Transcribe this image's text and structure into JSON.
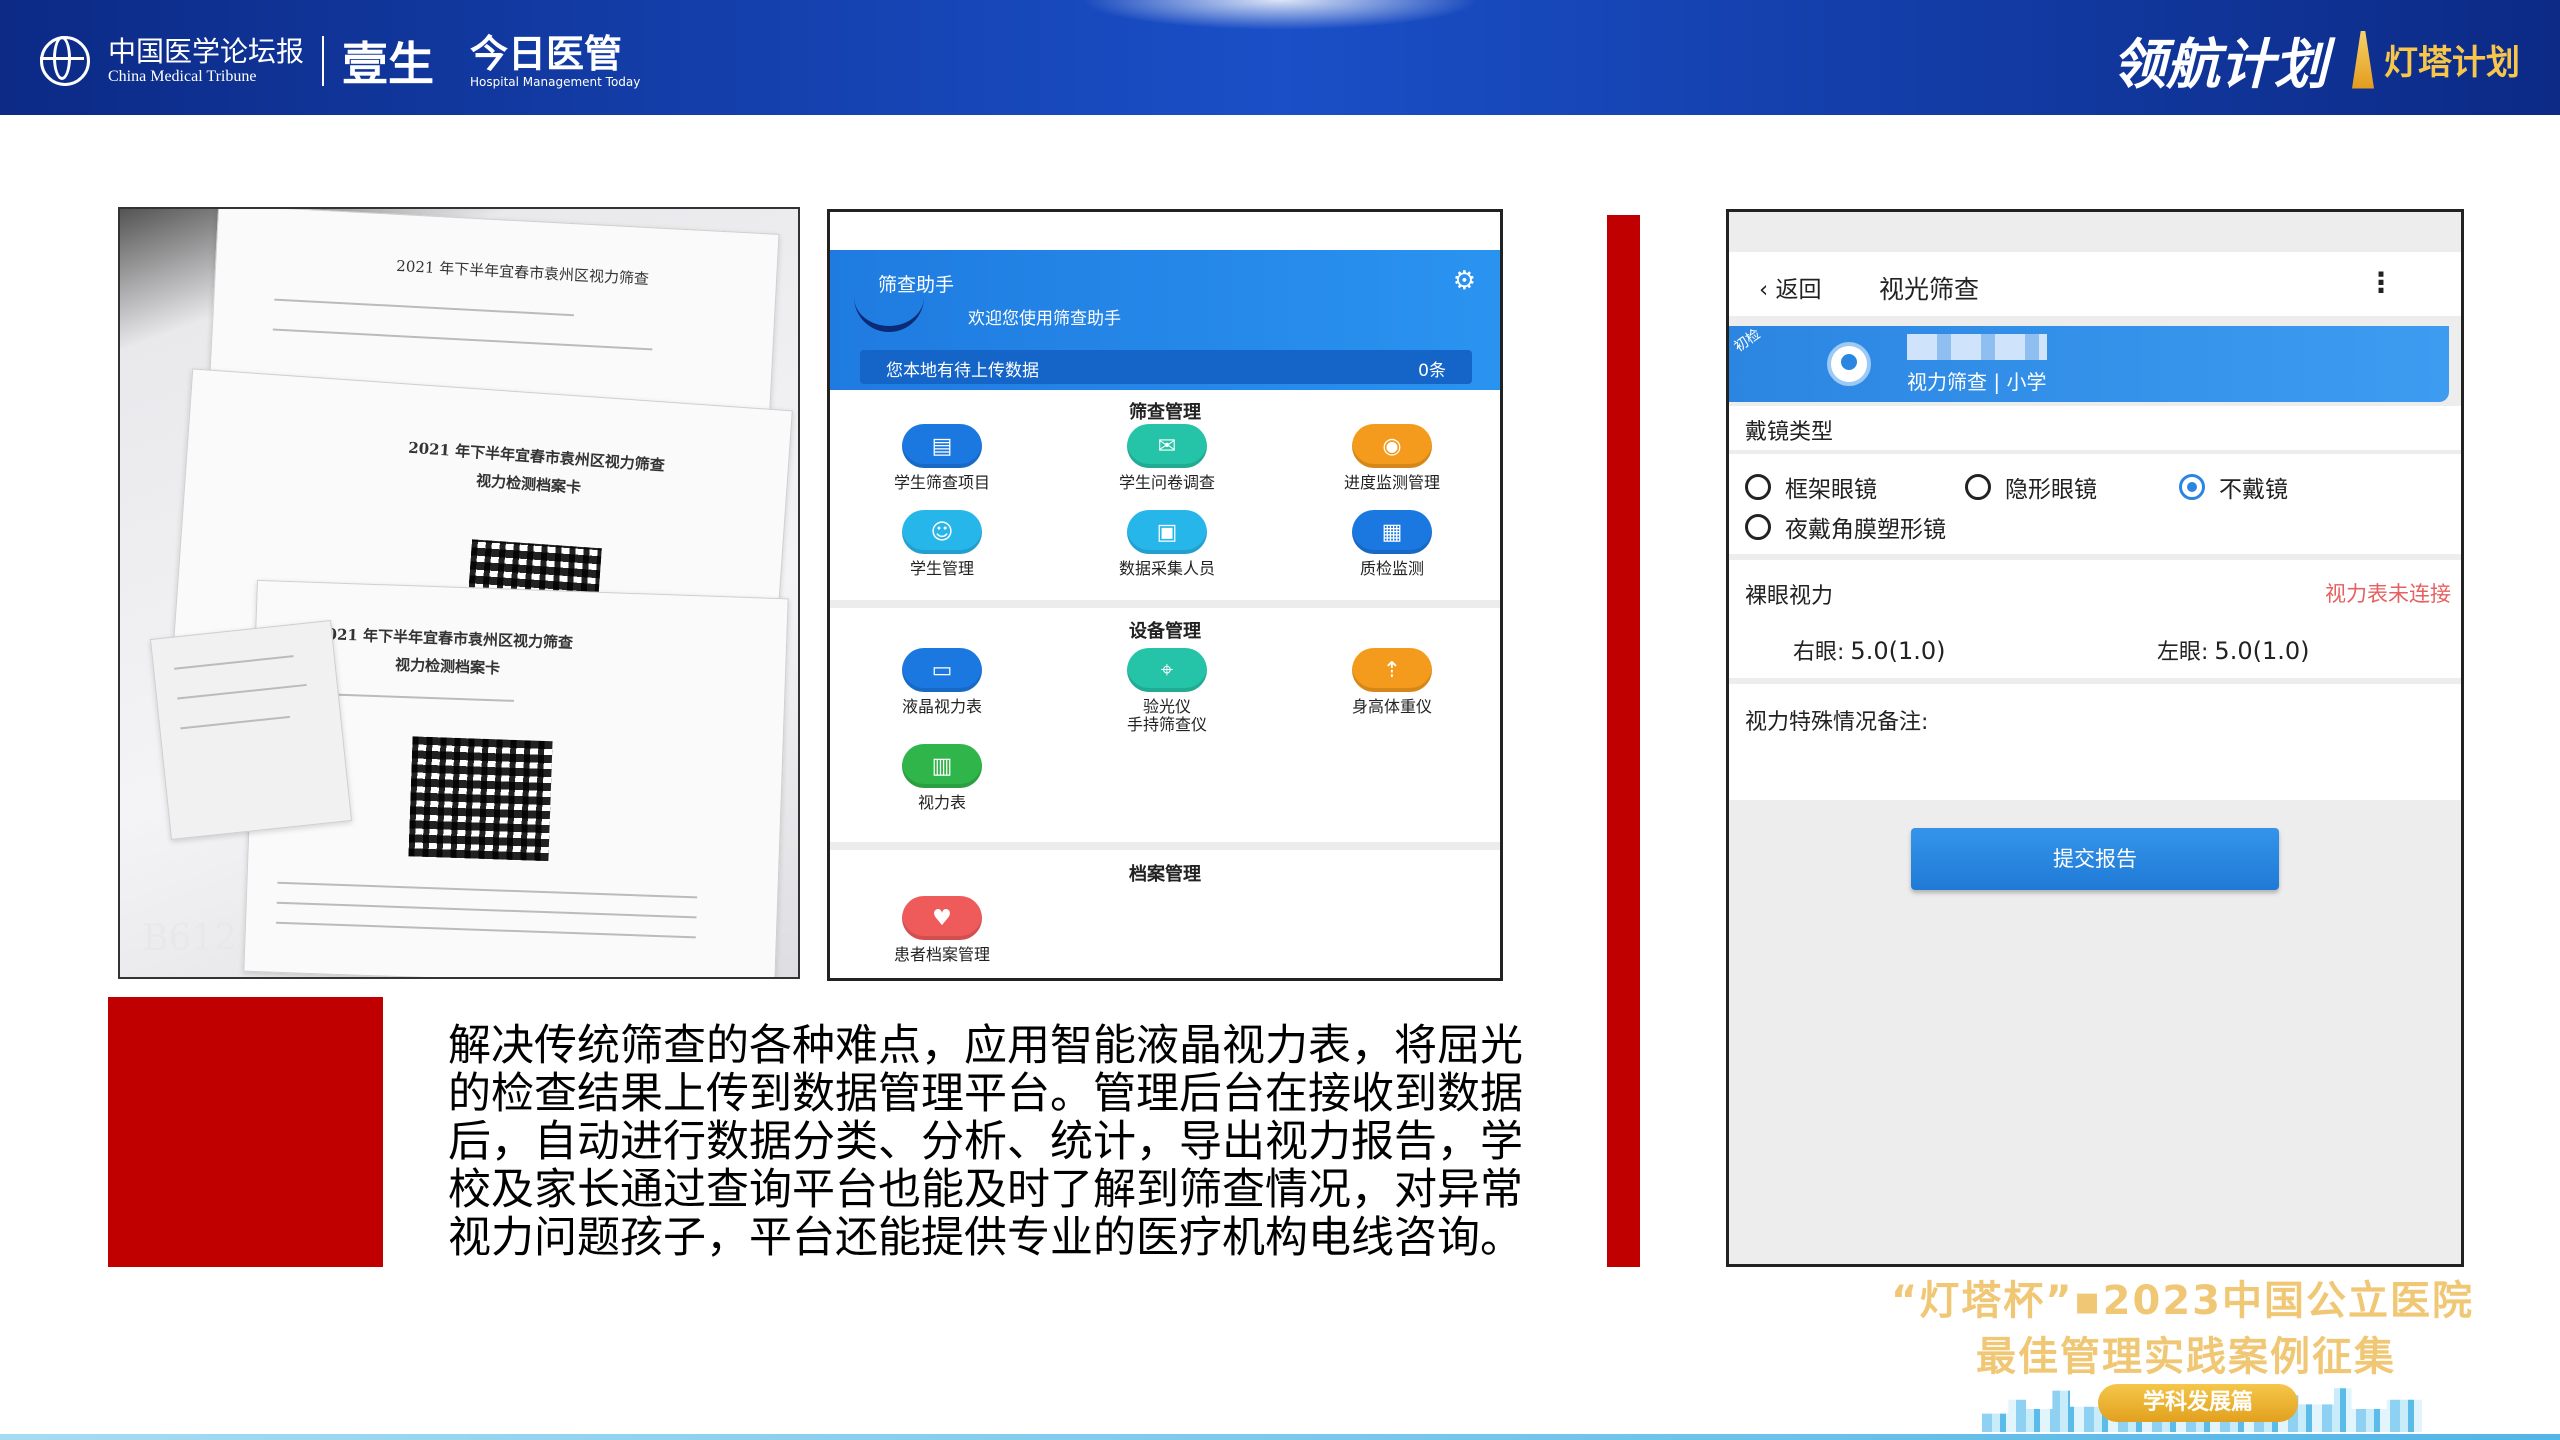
{
  "header": {
    "cmt_zh": "中国医学论坛报",
    "cmt_en": "China Medical Tribune",
    "yisheng": "壹生",
    "today_zh": "今日医管",
    "today_en": "Hospital Management Today",
    "lh_plan": "领航计划",
    "dt_plan": "灯塔计划"
  },
  "photo": {
    "sheet_titles": [
      "2021 年下半年宜春市袁州区视力筛查",
      "视力检测档案卡",
      "2021 年下半年宜春市袁州区视力筛查",
      "视力检测档案卡"
    ],
    "watermark": "B612"
  },
  "app1": {
    "title": "筛查助手",
    "welcome": "欢迎您使用筛查助手",
    "pending_label": "您本地有待上传数据",
    "pending_count": "0条",
    "sections": {
      "screening": "筛查管理",
      "device": "设备管理",
      "archive": "档案管理"
    },
    "screening_items": [
      "学生筛查项目",
      "学生问卷调查",
      "进度监测管理",
      "学生管理",
      "数据采集人员",
      "质检监测"
    ],
    "device_items": [
      "液晶视力表",
      "验光仪",
      "手持筛查仪",
      "身高体重仪",
      "视力表"
    ],
    "archive_items": [
      "患者档案管理"
    ]
  },
  "description": "解决传统筛查的各种难点，应用智能液晶视力表，将屈光的检查结果上传到数据管理平台。管理后台在接收到数据后，自动进行数据分类、分析、统计，导出视力报告，学校及家长通过查询平台也能及时了解到筛查情况，对异常视力问题孩子，平台还能提供专业的医疗机构电线咨询。",
  "app2": {
    "back": "返回",
    "title": "视光筛查",
    "tag": "初检",
    "subtitle": "视力筛查 | 小学",
    "glasses_type_label": "戴镜类型",
    "options": [
      "框架眼镜",
      "隐形眼镜",
      "不戴镜",
      "夜戴角膜塑形镜"
    ],
    "selected_option": "不戴镜",
    "naked_vision_label": "裸眼视力",
    "not_connected": "视力表未连接",
    "right_eye_label": "右眼:",
    "right_eye_value": "5.0(1.0)",
    "left_eye_label": "左眼:",
    "left_eye_value": "5.0(1.0)",
    "remark_label": "视力特殊情况备注:",
    "submit": "提交报告"
  },
  "brand": {
    "line1": "“灯塔杯”▪2023中国公立医院",
    "line2": "最佳管理实践案例征集",
    "pill": "学科发展篇"
  },
  "colors": {
    "header_blue": "#1a4fc7",
    "accent_red": "#c00000",
    "app_blue": "#2a93f0",
    "gold": "#f0c775"
  }
}
